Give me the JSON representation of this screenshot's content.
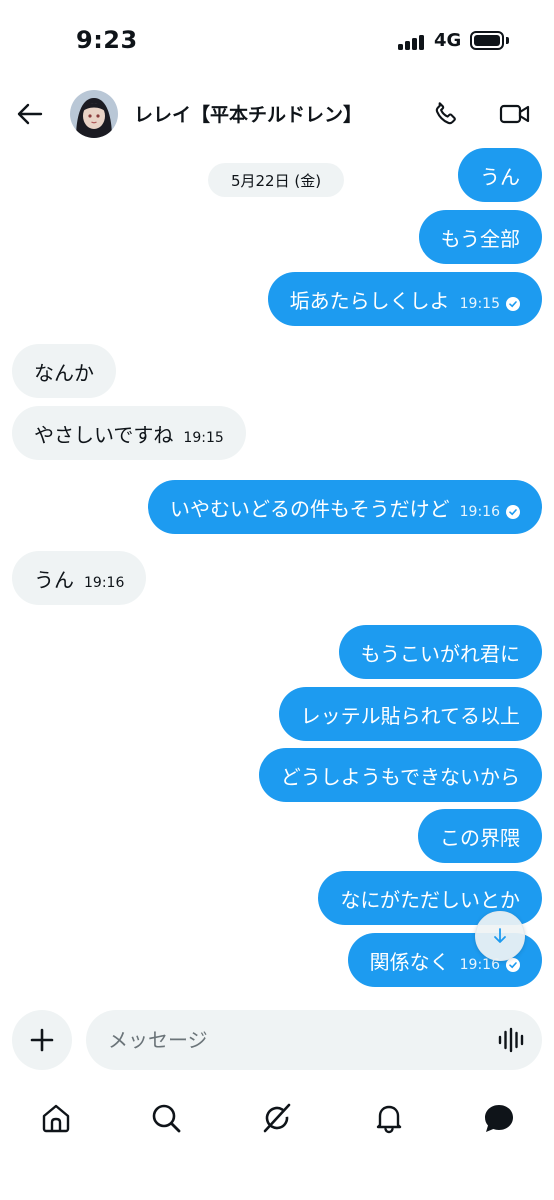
{
  "status_bar": {
    "time": "9:23",
    "network": "4G"
  },
  "header": {
    "contact_name": "レレイ【平本チルドレン】"
  },
  "chat": {
    "date_separator": "5月22日 (金)",
    "messages": [
      {
        "side": "out",
        "text": "うん",
        "time": ""
      },
      {
        "side": "out",
        "text": "もう全部",
        "time": ""
      },
      {
        "side": "out",
        "text": "垢あたらしくしよ",
        "time": "19:15",
        "read": true
      },
      {
        "side": "in",
        "text": "なんか",
        "time": ""
      },
      {
        "side": "in",
        "text": "やさしいですね",
        "time": "19:15"
      },
      {
        "side": "out",
        "text": "いやむいどるの件もそうだけど",
        "time": "19:16",
        "read": true
      },
      {
        "side": "in",
        "text": "うん",
        "time": "19:16"
      },
      {
        "side": "out",
        "text": "もうこいがれ君に",
        "time": ""
      },
      {
        "side": "out",
        "text": "レッテル貼られてる以上",
        "time": ""
      },
      {
        "side": "out",
        "text": "どうしようもできないから",
        "time": ""
      },
      {
        "side": "out",
        "text": "この界隈",
        "time": ""
      },
      {
        "side": "out",
        "text": "なにがただしいとか",
        "time": ""
      },
      {
        "side": "out",
        "text": "関係なく",
        "time": "19:16",
        "read": true
      }
    ]
  },
  "composer": {
    "placeholder": "メッセージ"
  },
  "colors": {
    "accent": "#1d9bf0",
    "incoming_bubble": "#eff3f4",
    "text": "#0f1419"
  },
  "nav": {
    "items": [
      "home-icon",
      "search-icon",
      "grok-icon",
      "notifications-icon",
      "messages-icon"
    ],
    "active": "messages-icon"
  }
}
